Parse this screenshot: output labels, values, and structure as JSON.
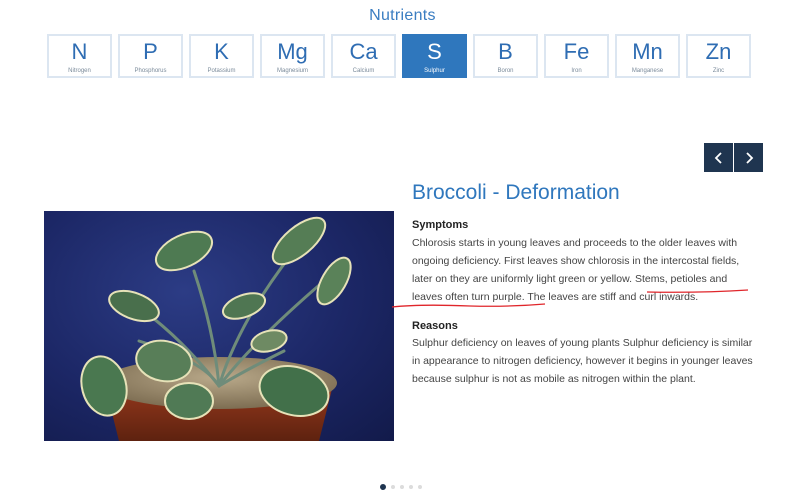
{
  "section": {
    "title": "Nutrients"
  },
  "nutrients": [
    {
      "symbol": "N",
      "name": "Nitrogen"
    },
    {
      "symbol": "P",
      "name": "Phosphorus"
    },
    {
      "symbol": "K",
      "name": "Potassium"
    },
    {
      "symbol": "Mg",
      "name": "Magnesium"
    },
    {
      "symbol": "Ca",
      "name": "Calcium"
    },
    {
      "symbol": "S",
      "name": "Sulphur",
      "active": true
    },
    {
      "symbol": "B",
      "name": "Boron"
    },
    {
      "symbol": "Fe",
      "name": "Iron"
    },
    {
      "symbol": "Mn",
      "name": "Manganese"
    },
    {
      "symbol": "Zn",
      "name": "Zinc"
    }
  ],
  "nav": {
    "prev_icon": "chevron-left-icon",
    "next_icon": "chevron-right-icon"
  },
  "detail": {
    "title": "Broccoli - Deformation",
    "symptoms_heading": "Symptoms",
    "symptoms_text": "Chlorosis starts in young leaves and proceeds to the older leaves with ongoing deficiency. First leaves show chlorosis in the intercostal fields, later on they are uniformly light green or yellow. Stems, petioles and leaves often turn purple. The leaves are stiff and curl inwards.",
    "reasons_heading": "Reasons",
    "reasons_text": "Sulphur deficiency on leaves of young plants Sulphur deficiency is similar in appearance to nitrogen deficiency, however it begins in younger leaves because sulphur is not as mobile as nitrogen within the plant."
  },
  "pagination": {
    "count": 5,
    "active_index": 0
  },
  "colors": {
    "accent": "#2f77bd",
    "dark": "#1f3550",
    "annotation": "#e0262b"
  }
}
